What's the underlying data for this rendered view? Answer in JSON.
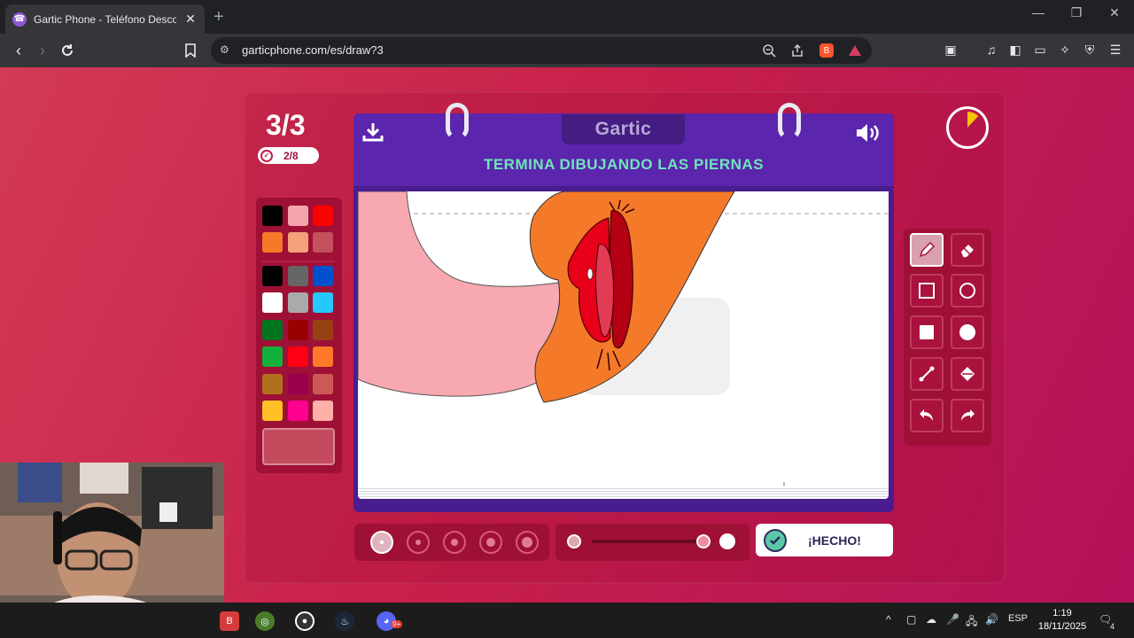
{
  "browser": {
    "tab_title": "Gartic Phone - Teléfono Descom",
    "url": "garticphone.com/es/draw?3",
    "new_tab": "+",
    "close_tab": "✕",
    "minimize": "—",
    "restore": "❐",
    "close_window": "✕",
    "shields_badge": "3"
  },
  "game": {
    "round": "3/3",
    "players_done": "2/8",
    "logo": "Gartic",
    "prompt": "TERMINA DIBUJANDO LAS PIERNAS",
    "done_label": "¡HECHO!",
    "timer_elapsed_fraction": 0.12,
    "brush_sizes": [
      1,
      2,
      3,
      4,
      5
    ],
    "selected_brush_size": 1,
    "opacity_level": 0.85,
    "active_tool": "pencil",
    "tools": [
      "pencil",
      "eraser",
      "rectangle-outline",
      "ellipse-outline",
      "rectangle-fill",
      "ellipse-fill",
      "line",
      "fill-bucket",
      "undo",
      "redo"
    ],
    "palette": [
      "#000000",
      "#f5a3ad",
      "#ff0000",
      "#f47a2a",
      "#f4a07a",
      "#c4505e",
      "#000000",
      "#666666",
      "#0050cd",
      "#ffffff",
      "#aaaaaa",
      "#26c9ff",
      "#017420",
      "#990000",
      "#964112",
      "#11b03c",
      "#ff0013",
      "#ff7829",
      "#b0701c",
      "#99004e",
      "#cb5a57",
      "#ffc126",
      "#ff008f",
      "#feafa8"
    ],
    "selected_color": "#c44a5e"
  },
  "taskbar": {
    "language": "ESP",
    "time": "1:19",
    "date": "18/11/2025",
    "discord_badge": "9+",
    "notifications": "4"
  }
}
